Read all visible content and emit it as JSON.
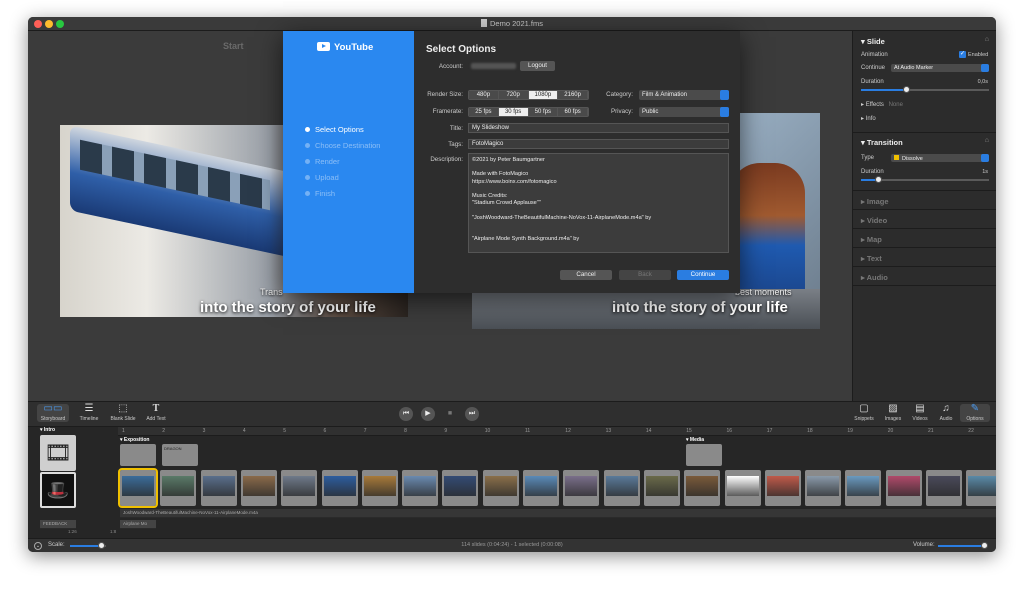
{
  "window": {
    "title": "Demo 2021.fms",
    "traffic_lights": [
      "#ff5f57",
      "#febc2e",
      "#28c840"
    ]
  },
  "preview": {
    "left_title": "Start",
    "caption_left_small": "Trans",
    "caption_right_small": "best moments",
    "caption_main": "into the story of your life"
  },
  "dialog": {
    "brand": "YouTube",
    "steps": [
      {
        "label": "Select Options",
        "active": true
      },
      {
        "label": "Choose Destination",
        "active": false
      },
      {
        "label": "Render",
        "active": false
      },
      {
        "label": "Upload",
        "active": false
      },
      {
        "label": "Finish",
        "active": false
      }
    ],
    "heading": "Select Options",
    "account_label": "Account:",
    "logout": "Logout",
    "render_size_label": "Render Size:",
    "render_sizes": [
      "480p",
      "720p",
      "1080p",
      "2160p"
    ],
    "render_size_selected": "1080p",
    "framerate_label": "Framerate:",
    "framerates": [
      "25 fps",
      "30 fps",
      "50 fps",
      "60 fps"
    ],
    "framerate_selected": "30 fps",
    "category_label": "Category:",
    "category_value": "Film & Animation",
    "privacy_label": "Privacy:",
    "privacy_value": "Public",
    "title_label": "Title:",
    "title_value": "My Slideshow",
    "tags_label": "Tags:",
    "tags_value": "FotoMagico",
    "description_label": "Description:",
    "description_lines": [
      "©2021 by Peter Baumgartner",
      "",
      "Made with FotoMagico",
      "https://www.boinx.com/fotomagico",
      "",
      "Music Credits:",
      "\"Stadium Crowd Applause\"\"",
      "",
      "\"JoshWoodward-TheBeautifulMachine-NoVox-11-AirplaneMode.m4a\" by",
      "",
      "",
      "\"Airplane Mode Synth Background.m4a\" by"
    ],
    "cancel": "Cancel",
    "back": "Back",
    "continue": "Continue"
  },
  "inspector": {
    "slide_header": "Slide",
    "animation_label": "Animation",
    "enabled_label": "Enabled",
    "continue_label": "Continue",
    "continue_value": "At Audio Marker",
    "duration_label": "Duration",
    "duration_value": "0,0s",
    "effects_label": "Effects",
    "effects_value": "None",
    "info_label": "Info",
    "transition_header": "Transition",
    "type_label": "Type",
    "type_value": "Dissolve",
    "tr_duration_label": "Duration",
    "tr_duration_value": "1s",
    "collapsed": [
      "Image",
      "Video",
      "Map",
      "Text",
      "Audio"
    ]
  },
  "toolbar": {
    "left": [
      "Storyboard",
      "Timeline",
      "Blank Slide",
      "Add Text"
    ],
    "right": [
      "Snippets",
      "Images",
      "Videos",
      "Audio",
      "Options"
    ]
  },
  "storyboard": {
    "intro_label": "Intro",
    "marker_left": "Exposition",
    "marker_right": "Media",
    "small_tag": "DRAGON",
    "audio_track_1": "JoshWoodward-TheBeautifulMachine-NoVox-11-AirplaneMode.m4a",
    "audio_track_2": "Airplane Mo",
    "audio_tag_left": "FEEDBACK",
    "time_left": "1:26",
    "time_left2": "1:8",
    "ruler_numbers": [
      "1",
      "2",
      "3",
      "4",
      "5",
      "6",
      "7",
      "8",
      "9",
      "10",
      "11",
      "12",
      "13",
      "14",
      "15",
      "16",
      "17",
      "18",
      "19",
      "20",
      "21",
      "22",
      "23",
      "24"
    ],
    "slide_colors": [
      "#3b6c9a",
      "#5a7a68",
      "#5a6f8c",
      "#8a6a4a",
      "#6f7a8a",
      "#2d5d9e",
      "#a87a3a",
      "#6a8ab0",
      "#334b74",
      "#8a6f4a",
      "#5a8ab8",
      "#7a6f8a",
      "#5a7a9a",
      "#6a6a4a",
      "#7a5a3a",
      "#ffffff",
      "#c05a4a",
      "#8a9aaa",
      "#6a9ac0",
      "#b04a6a",
      "#4a4a5a",
      "#5a8aa8",
      "#7a6a5a"
    ]
  },
  "status": {
    "scale_label": "Scale:",
    "info": "114 slides (0:04:24) - 1 selected (0:00:08)",
    "volume_label": "Volume:"
  }
}
